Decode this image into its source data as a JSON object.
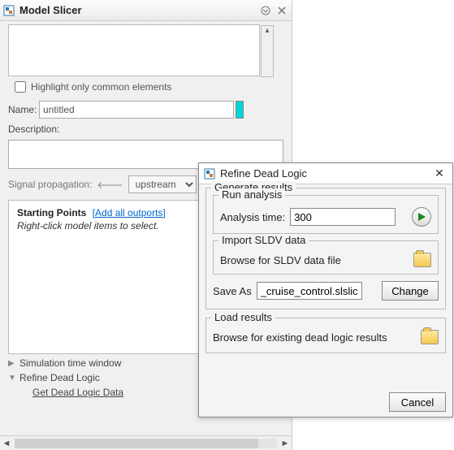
{
  "panel": {
    "title": "Model Slicer",
    "highlight_label": "Highlight only common elements",
    "name_label": "Name:",
    "name_value": "untitled",
    "description_label": "Description:",
    "signal_label": "Signal propagation:",
    "signal_value": "upstream",
    "starting_points_label": "Starting Points",
    "add_all_outports": "[Add all outports]",
    "starting_points_hint": "Right-click model items to select.",
    "sim_time_window": "Simulation time window",
    "refine_dead_logic": "Refine Dead Logic",
    "get_dead_logic": "Get Dead Logic Data"
  },
  "dialog": {
    "title": "Refine Dead Logic",
    "generate_results": "Generate results",
    "run_analysis": "Run analysis",
    "analysis_time_label": "Analysis time:",
    "analysis_time_value": "300",
    "import_sldv": "Import SLDV data",
    "browse_sldv": "Browse for SLDV data file",
    "save_as_label": "Save As",
    "save_as_value": "_cruise_control.slslicex",
    "change": "Change",
    "load_results": "Load results",
    "browse_existing": "Browse for existing dead logic results",
    "cancel": "Cancel"
  }
}
